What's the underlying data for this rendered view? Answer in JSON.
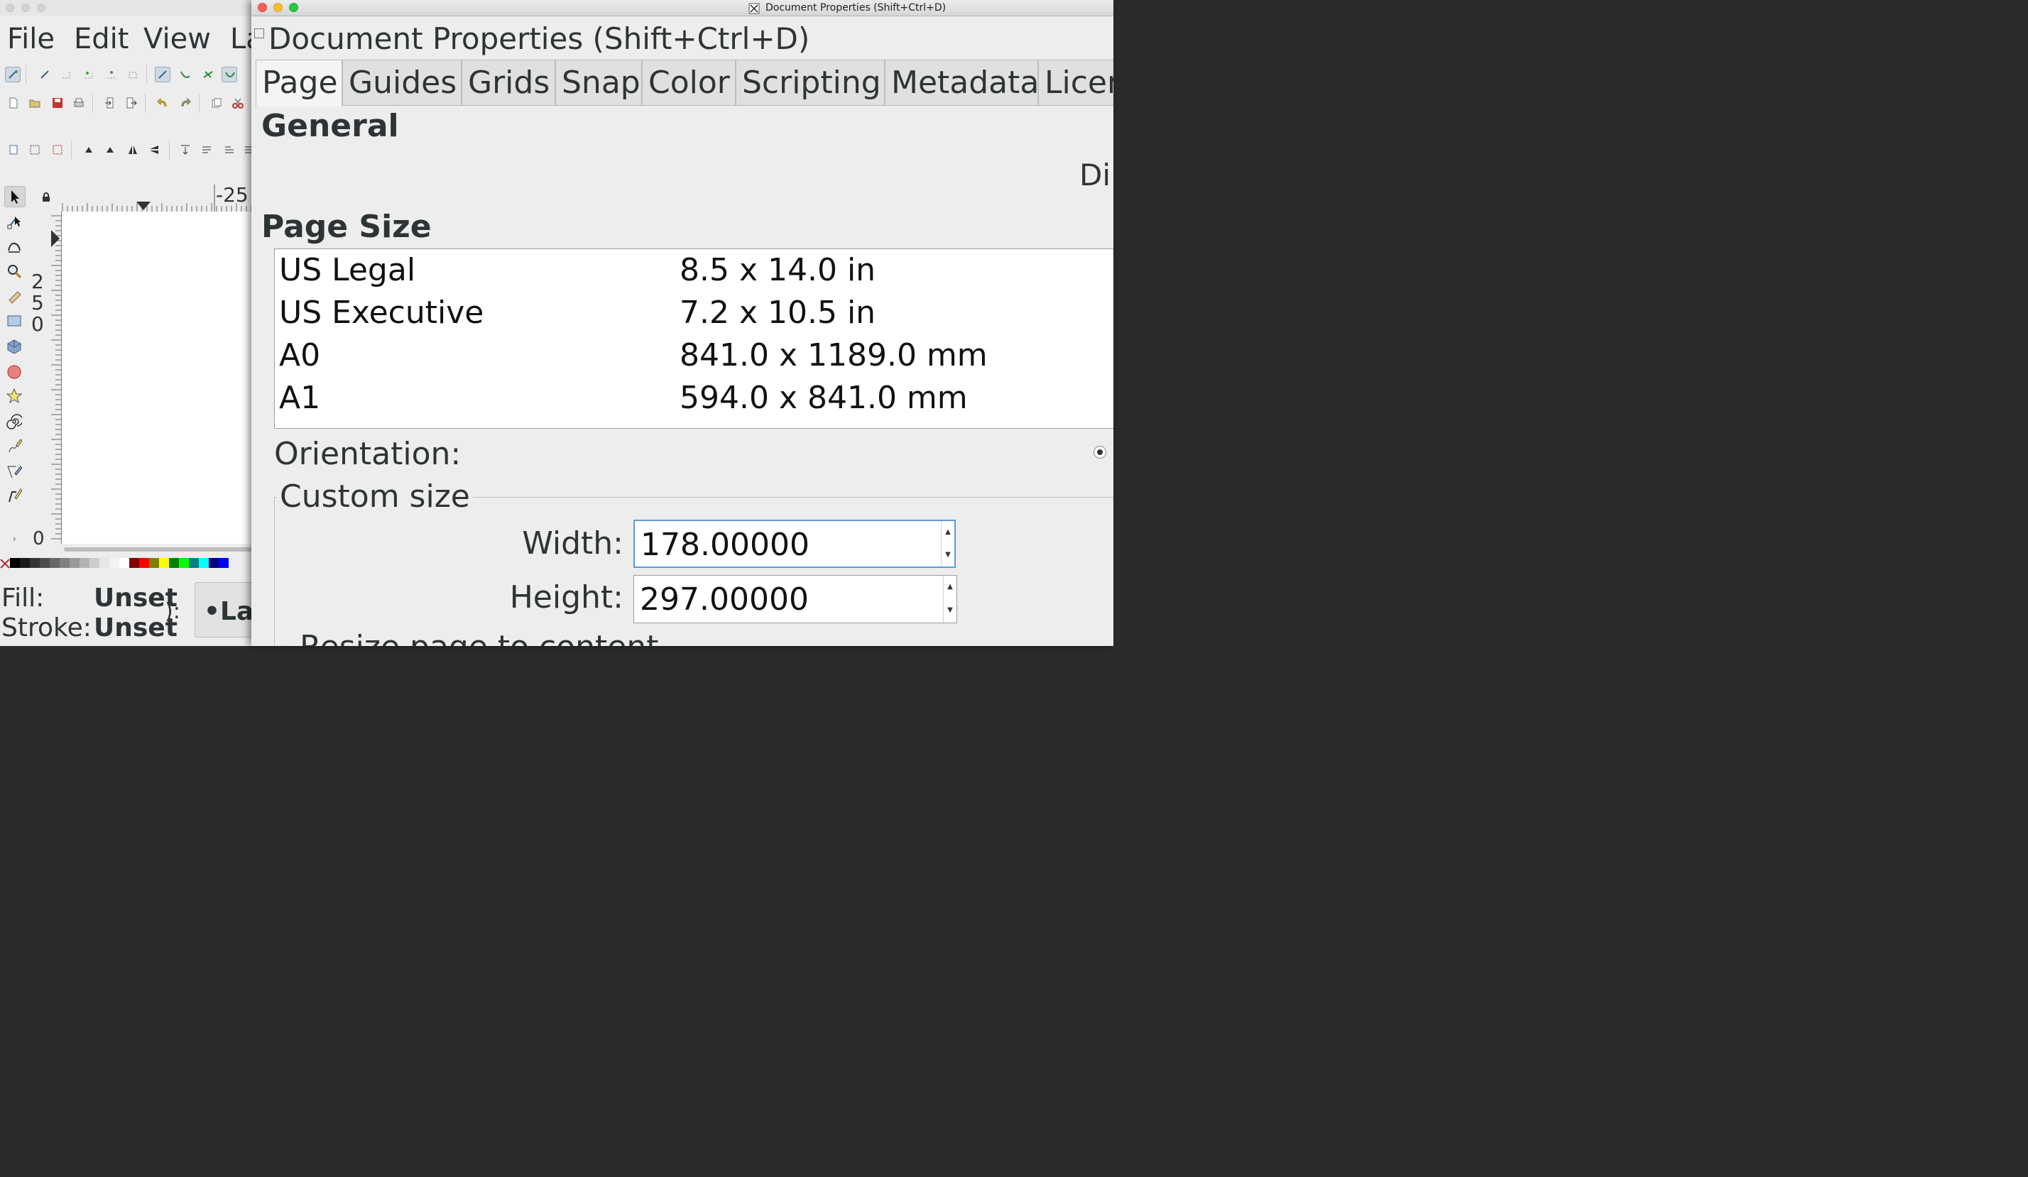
{
  "main_window": {
    "menu": [
      "File",
      "Edit",
      "View",
      "La"
    ],
    "ruler": {
      "top_label": "-25",
      "left_label_digits": [
        "2",
        "5",
        "0"
      ],
      "left_bottom_label": "0"
    },
    "palette_colors": [
      "#000000",
      "#1a1a1a",
      "#333333",
      "#4d4d4d",
      "#666666",
      "#808080",
      "#999999",
      "#b3b3b3",
      "#cccccc",
      "#e6e6e6",
      "#f2f2f2",
      "#ffffff",
      "#800000",
      "#ff0000",
      "#808000",
      "#ffff00",
      "#008000",
      "#00ff00",
      "#008080",
      "#00ffff",
      "#000080",
      "#0000ff"
    ],
    "status": {
      "fill_label": "Fill:",
      "fill_value": "Unset",
      "stroke_label": "Stroke:",
      "stroke_value": "Unset",
      "layer_fragment": "•Lay",
      "partial_text": "):"
    }
  },
  "dialog": {
    "window_title": "Document Properties (Shift+Ctrl+D)",
    "header": "Document Properties (Shift+Ctrl+D)",
    "tabs": [
      {
        "label": "Page",
        "active": true
      },
      {
        "label": "Guides",
        "active": false
      },
      {
        "label": "Grids",
        "active": false
      },
      {
        "label": "Snap",
        "active": false
      },
      {
        "label": "Color",
        "active": false
      },
      {
        "label": "Scripting",
        "active": false
      },
      {
        "label": "Metadata",
        "active": false
      },
      {
        "label": "Licer",
        "active": false
      }
    ],
    "general_title": "General",
    "display_units_fragment": "Di",
    "page_size_title": "Page Size",
    "page_sizes": [
      {
        "name": "US Legal",
        "size": "8.5 x 14.0 in"
      },
      {
        "name": "US Executive",
        "size": "7.2 x 10.5 in"
      },
      {
        "name": "A0",
        "size": "841.0 x 1189.0 mm"
      },
      {
        "name": "A1",
        "size": "594.0 x 841.0 mm"
      }
    ],
    "orientation_label": "Orientation:",
    "custom_size": {
      "title": "Custom size",
      "width_label": "Width:",
      "width_value": "178.00000",
      "height_label": "Height:",
      "height_value": "297.00000"
    },
    "resize_link": "Resize page to content"
  }
}
